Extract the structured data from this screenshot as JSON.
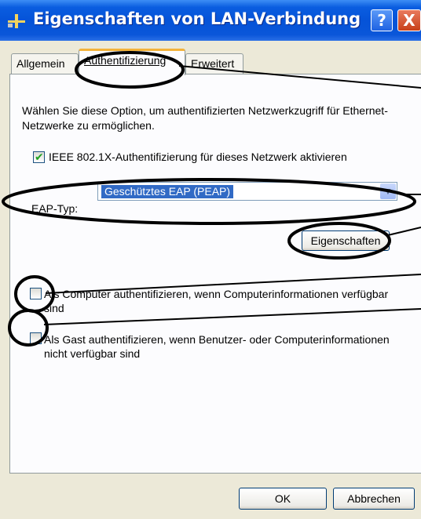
{
  "window": {
    "title": "Eigenschaften von LAN-Verbindung",
    "help_label": "?",
    "close_label": "X"
  },
  "tabs": [
    {
      "label": "Allgemein"
    },
    {
      "label": "Authentifizierung"
    },
    {
      "label": "Erweitert"
    }
  ],
  "panel": {
    "intro": "Wählen Sie diese Option, um authentifizierten Netzwerkzugriff für Ethernet-Netzwerke zu ermöglichen.",
    "ieee_checkbox": {
      "label": "IEEE 802.1X-Authentifizierung für dieses Netzwerk aktivieren",
      "checked": true
    },
    "eap": {
      "label": "EAP-Typ:",
      "value": "Geschütztes EAP (PEAP)"
    },
    "properties_button": "Eigenschaften",
    "computer_checkbox": {
      "label": "Als Computer authentifizieren, wenn Computerinformationen verfügbar sind",
      "checked": false
    },
    "guest_checkbox": {
      "label": "Als Gast authentifizieren, wenn Benutzer- oder Computerinformationen nicht verfügbar sind",
      "checked": false
    }
  },
  "footer": {
    "ok": "OK",
    "cancel": "Abbrechen"
  },
  "colors": {
    "titlebar": "#0553d8",
    "dialog_bg": "#ece9d8",
    "selection": "#316ac5",
    "annotation": "#000000"
  }
}
